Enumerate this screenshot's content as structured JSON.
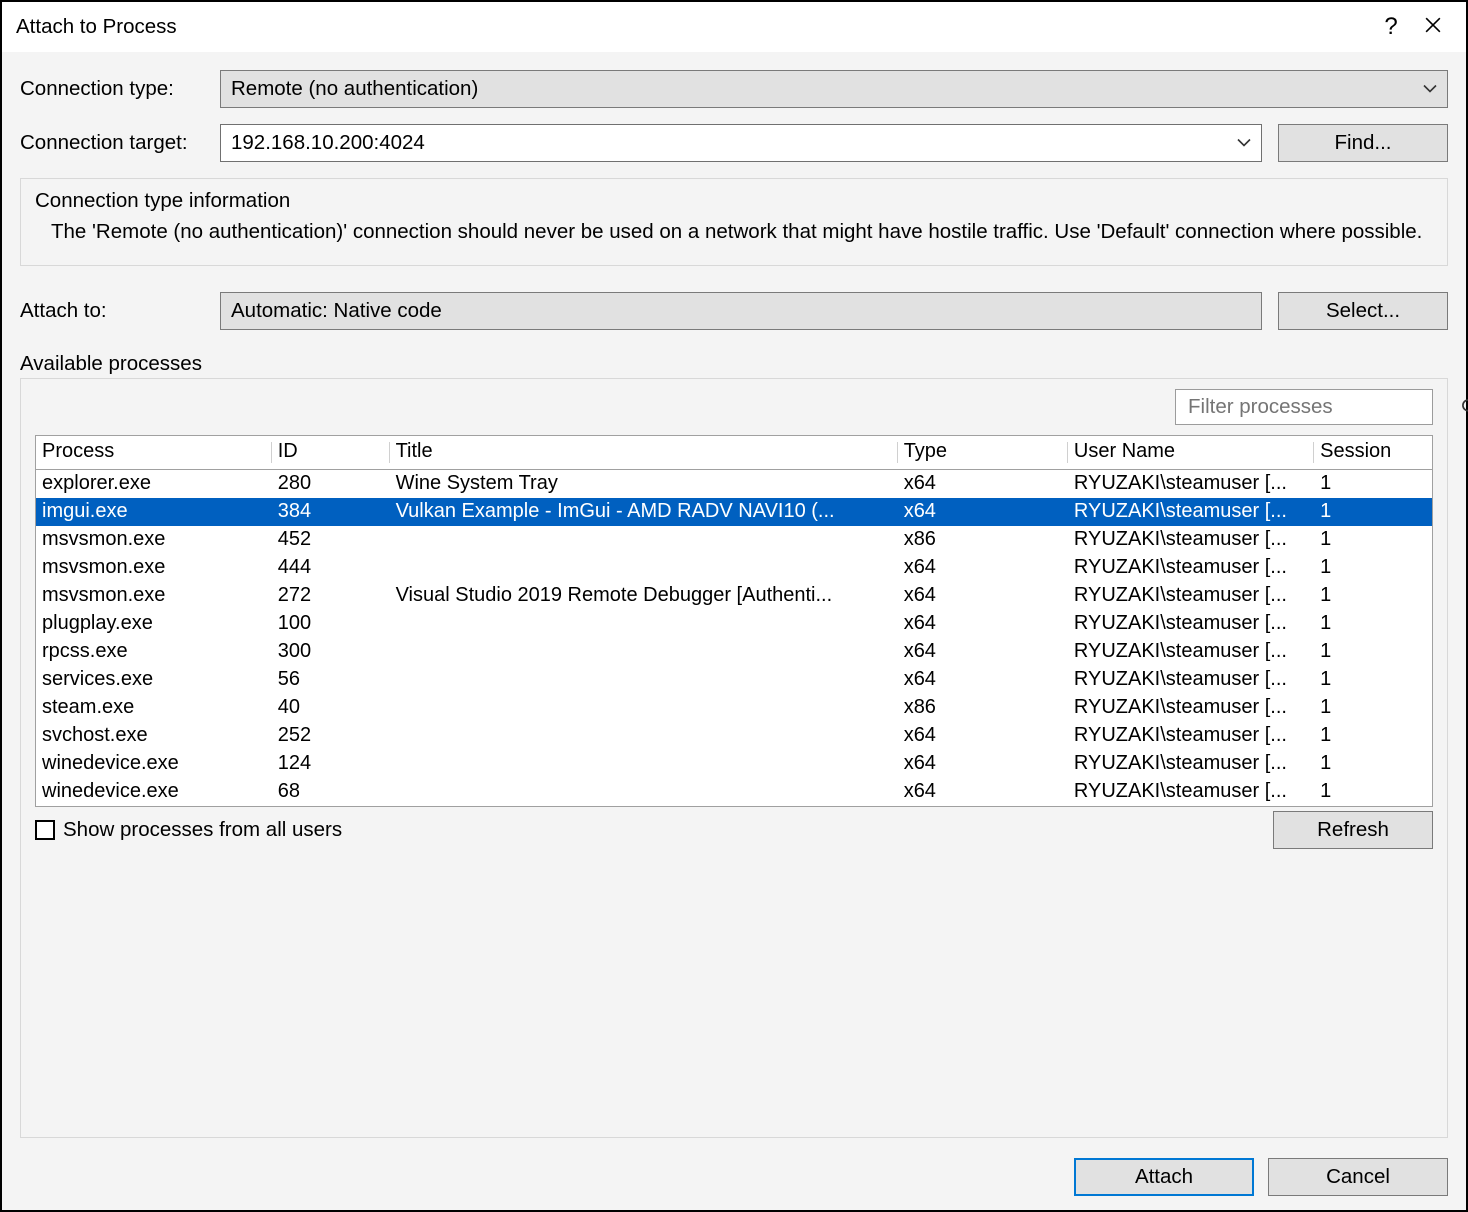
{
  "window": {
    "title": "Attach to Process"
  },
  "labels": {
    "connection_type": "Connection type:",
    "connection_target": "Connection target:",
    "attach_to": "Attach to:",
    "group_info": "Connection type information",
    "group_processes": "Available processes",
    "show_all": "Show processes from all users"
  },
  "fields": {
    "connection_type_value": "Remote (no authentication)",
    "connection_target_value": "192.168.10.200:4024",
    "attach_to_value": "Automatic: Native code",
    "filter_placeholder": "Filter processes"
  },
  "info_text": "The 'Remote (no authentication)' connection should never be used on a network that might have hostile traffic. Use 'Default' connection where possible.",
  "buttons": {
    "find": "Find...",
    "select": "Select...",
    "refresh": "Refresh",
    "attach": "Attach",
    "cancel": "Cancel"
  },
  "table": {
    "columns": [
      "Process",
      "ID",
      "Title",
      "Type",
      "User Name",
      "Session"
    ],
    "selected_index": 1,
    "rows": [
      {
        "process": "explorer.exe",
        "id": "280",
        "title": "Wine System Tray",
        "type": "x64",
        "user": "RYUZAKI\\steamuser [...",
        "session": "1"
      },
      {
        "process": "imgui.exe",
        "id": "384",
        "title": "Vulkan Example - ImGui - AMD RADV NAVI10 (...",
        "type": "x64",
        "user": "RYUZAKI\\steamuser [...",
        "session": "1"
      },
      {
        "process": "msvsmon.exe",
        "id": "452",
        "title": "",
        "type": "x86",
        "user": "RYUZAKI\\steamuser [...",
        "session": "1"
      },
      {
        "process": "msvsmon.exe",
        "id": "444",
        "title": "",
        "type": "x64",
        "user": "RYUZAKI\\steamuser [...",
        "session": "1"
      },
      {
        "process": "msvsmon.exe",
        "id": "272",
        "title": "Visual Studio 2019 Remote Debugger [Authenti...",
        "type": "x64",
        "user": "RYUZAKI\\steamuser [...",
        "session": "1"
      },
      {
        "process": "plugplay.exe",
        "id": "100",
        "title": "",
        "type": "x64",
        "user": "RYUZAKI\\steamuser [...",
        "session": "1"
      },
      {
        "process": "rpcss.exe",
        "id": "300",
        "title": "",
        "type": "x64",
        "user": "RYUZAKI\\steamuser [...",
        "session": "1"
      },
      {
        "process": "services.exe",
        "id": "56",
        "title": "",
        "type": "x64",
        "user": "RYUZAKI\\steamuser [...",
        "session": "1"
      },
      {
        "process": "steam.exe",
        "id": "40",
        "title": "",
        "type": "x86",
        "user": "RYUZAKI\\steamuser [...",
        "session": "1"
      },
      {
        "process": "svchost.exe",
        "id": "252",
        "title": "",
        "type": "x64",
        "user": "RYUZAKI\\steamuser [...",
        "session": "1"
      },
      {
        "process": "winedevice.exe",
        "id": "124",
        "title": "",
        "type": "x64",
        "user": "RYUZAKI\\steamuser [...",
        "session": "1"
      },
      {
        "process": "winedevice.exe",
        "id": "68",
        "title": "",
        "type": "x64",
        "user": "RYUZAKI\\steamuser [...",
        "session": "1"
      }
    ]
  }
}
